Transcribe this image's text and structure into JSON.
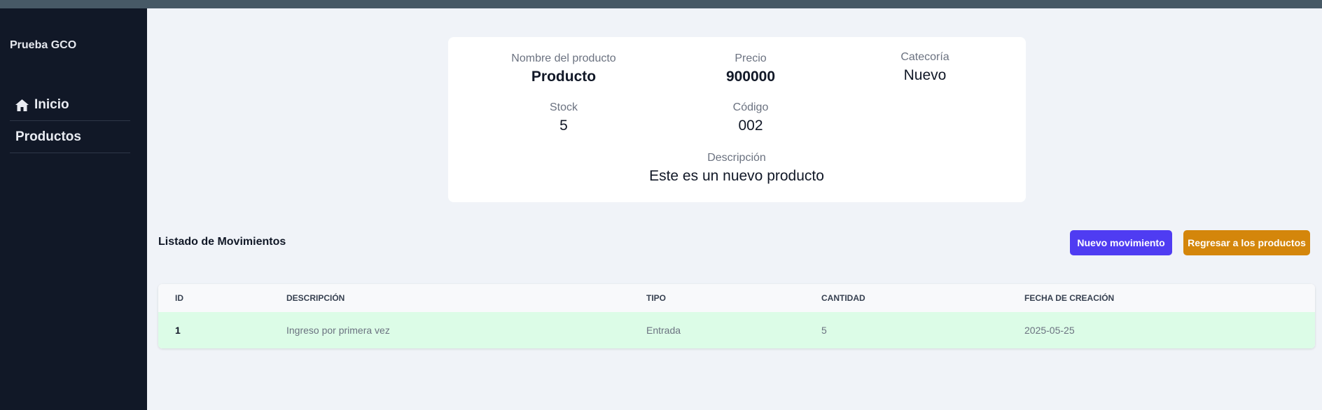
{
  "app": {
    "brand": "Prueba GCO"
  },
  "sidebar": {
    "items": [
      {
        "label": "Inicio",
        "icon": "home-icon"
      },
      {
        "label": "Productos"
      }
    ]
  },
  "product": {
    "name_label": "Nombre del producto",
    "name": "Producto",
    "price_label": "Precio",
    "price": "900000",
    "category_label": "Catecoría",
    "category": "Nuevo",
    "stock_label": "Stock",
    "stock": "5",
    "code_label": "Código",
    "code": "002",
    "description_label": "Descripción",
    "description": "Este es un nuevo producto"
  },
  "movements": {
    "title": "Listado de Movimientos",
    "new_button": "Nuevo movimiento",
    "back_button": "Regresar a los productos",
    "columns": [
      "ID",
      "DESCRIPCIÓN",
      "TIPO",
      "CANTIDAD",
      "FECHA DE CREACIÓN"
    ],
    "rows": [
      {
        "id": "1",
        "description": "Ingreso por primera vez",
        "type": "Entrada",
        "quantity": "5",
        "created": "2025-05-25"
      }
    ]
  },
  "colors": {
    "sidebar_bg": "#111827",
    "primary_button": "#4f3cf2",
    "secondary_button": "#d4860b",
    "row_highlight": "#dcfce7"
  }
}
